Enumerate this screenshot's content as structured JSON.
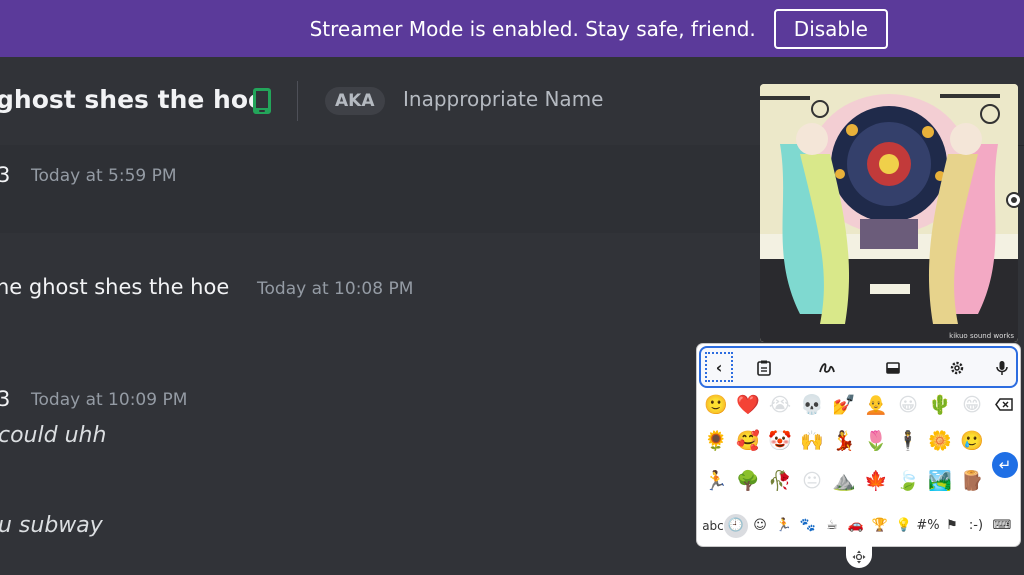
{
  "banner": {
    "text": "Streamer Mode is enabled. Stay safe, friend.",
    "button_label": "Disable"
  },
  "header": {
    "channel_title": "ghost shes the hoe",
    "aka_label": "AKA",
    "aka_name": "Inappropriate Name",
    "status_color": "#23a55a"
  },
  "messages": [
    {
      "author": "3",
      "time": "Today at 5:59 PM",
      "content": ""
    },
    {
      "author": "he ghost shes the hoe",
      "time": "Today at 10:08 PM",
      "content": ""
    },
    {
      "author": "3",
      "time": "Today at 10:09 PM",
      "content": "could uhh"
    },
    {
      "author": "",
      "time": "",
      "content": "u subway"
    }
  ],
  "album_art": {
    "caption": "kikuo sound works"
  },
  "keyboard": {
    "toolbar": [
      "back-arrow",
      "clipboard-icon",
      "handwriting-icon",
      "one-handed-icon",
      "settings-icon",
      "microphone-icon"
    ],
    "emoji_rows": [
      [
        "🙂",
        "❤️",
        "😭",
        "💀",
        "💅",
        "🧑‍🦲",
        "😀",
        "🌵",
        "😁"
      ],
      [
        "🌻",
        "🥰",
        "🤡",
        "🙌",
        "💃",
        "🌷",
        "🕴️",
        "🌼",
        "🥲"
      ],
      [
        "🏃",
        "🌳",
        "🥀",
        "😐",
        "⛰️",
        "🍁",
        "🍃",
        "🏞️",
        "🪵"
      ]
    ],
    "categories": [
      "abc",
      "🕘",
      "☺",
      "🏃",
      "🐾",
      "☕",
      "🚗",
      "🏆",
      "💡",
      "#%",
      "⚑",
      ":-)",
      "⌨"
    ],
    "active_category": 1,
    "accent": "#1f6fe5"
  }
}
